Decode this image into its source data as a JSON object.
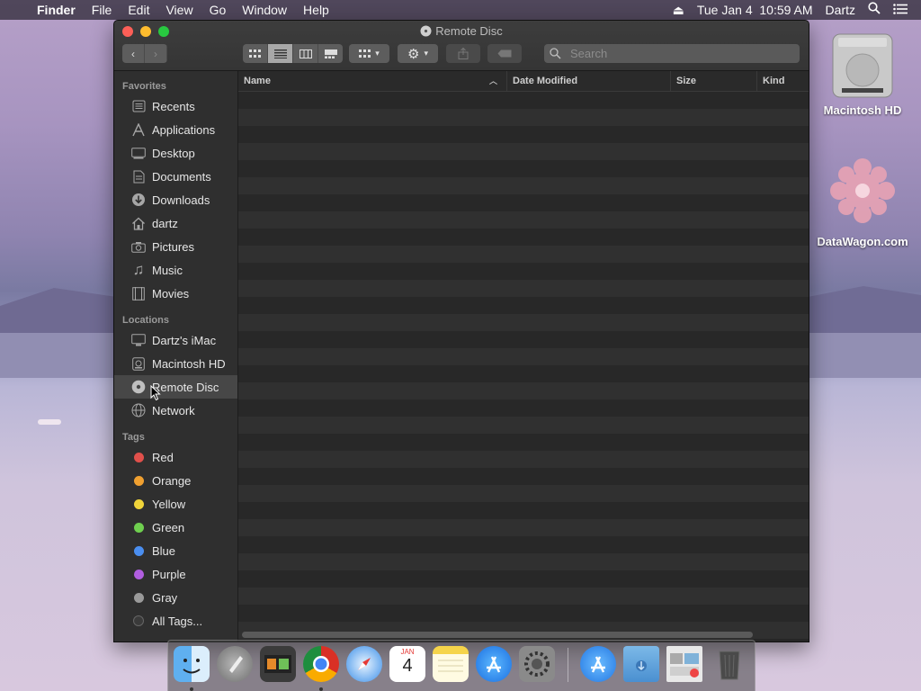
{
  "menubar": {
    "apple": "",
    "app": "Finder",
    "items": [
      "File",
      "Edit",
      "View",
      "Go",
      "Window",
      "Help"
    ],
    "datetime": "Tue Jan 4  10:59 AM",
    "user": "Dartz"
  },
  "desktop": {
    "icons": [
      {
        "label": "Macintosh HD"
      },
      {
        "label": "DataWagon.com"
      }
    ]
  },
  "window": {
    "title": "Remote Disc",
    "search_placeholder": "Search",
    "columns": {
      "name": "Name",
      "date": "Date Modified",
      "size": "Size",
      "kind": "Kind"
    },
    "sections": {
      "favorites": "Favorites",
      "locations": "Locations",
      "tags": "Tags"
    },
    "favorites": [
      "Recents",
      "Applications",
      "Desktop",
      "Documents",
      "Downloads",
      "dartz",
      "Pictures",
      "Music",
      "Movies"
    ],
    "locations": [
      "Dartz's iMac",
      "Macintosh HD",
      "Remote Disc",
      "Network"
    ],
    "tags": [
      {
        "label": "Red",
        "color": "#e0504b"
      },
      {
        "label": "Orange",
        "color": "#f0a030"
      },
      {
        "label": "Yellow",
        "color": "#f0d43a"
      },
      {
        "label": "Green",
        "color": "#6fcf4f"
      },
      {
        "label": "Blue",
        "color": "#4a8ef0"
      },
      {
        "label": "Purple",
        "color": "#b15ee0"
      },
      {
        "label": "Gray",
        "color": "#9a9a9a"
      },
      {
        "label": "All Tags...",
        "color": "#3a3a3a"
      }
    ]
  },
  "dock": {
    "apps": [
      "Finder",
      "Launchpad",
      "Photo Browser",
      "Chrome",
      "Safari",
      "Calendar",
      "Notes",
      "App Store",
      "System Preferences",
      "App Store",
      "Downloads",
      "Documents",
      "Trash"
    ],
    "calendar": {
      "month": "JAN",
      "day": "4"
    }
  }
}
